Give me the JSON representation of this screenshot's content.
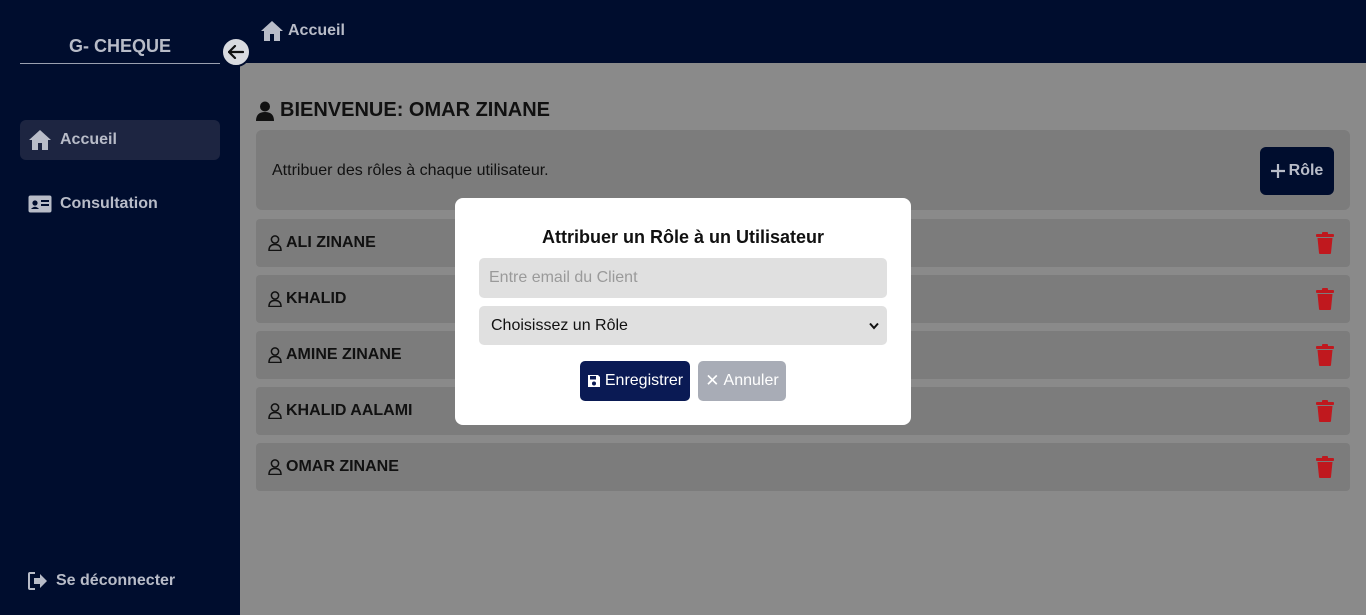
{
  "sidebar": {
    "brand": "G- CHEQUE",
    "items": [
      {
        "label": "Accueil",
        "icon": "home-icon",
        "active": true
      },
      {
        "label": "Consultation",
        "icon": "id-card-icon",
        "active": false
      }
    ],
    "logout_label": "Se déconnecter"
  },
  "header": {
    "breadcrumb": "Accueil"
  },
  "main": {
    "welcome": "BIENVENUE: OMAR ZINANE",
    "banner_text": "Attribuer des rôles à chaque utilisateur.",
    "add_role_label": "Rôle",
    "users": [
      "ALI ZINANE",
      "KHALID",
      "AMINE ZINANE",
      "KHALID AALAMI",
      "OMAR ZINANE"
    ]
  },
  "modal": {
    "title": "Attribuer un Rôle à un Utilisateur",
    "email_placeholder": "Entre email du Client",
    "select_value": "Choisissez un Rôle",
    "save_label": "Enregistrer",
    "cancel_label": "Annuler"
  },
  "colors": {
    "sidebar_bg": "#000d2e",
    "overlay_bg": "#8a8a8a",
    "save_button": "#0a1a54",
    "cancel_button": "#a8acb6",
    "delete_icon": "#c0181e"
  }
}
